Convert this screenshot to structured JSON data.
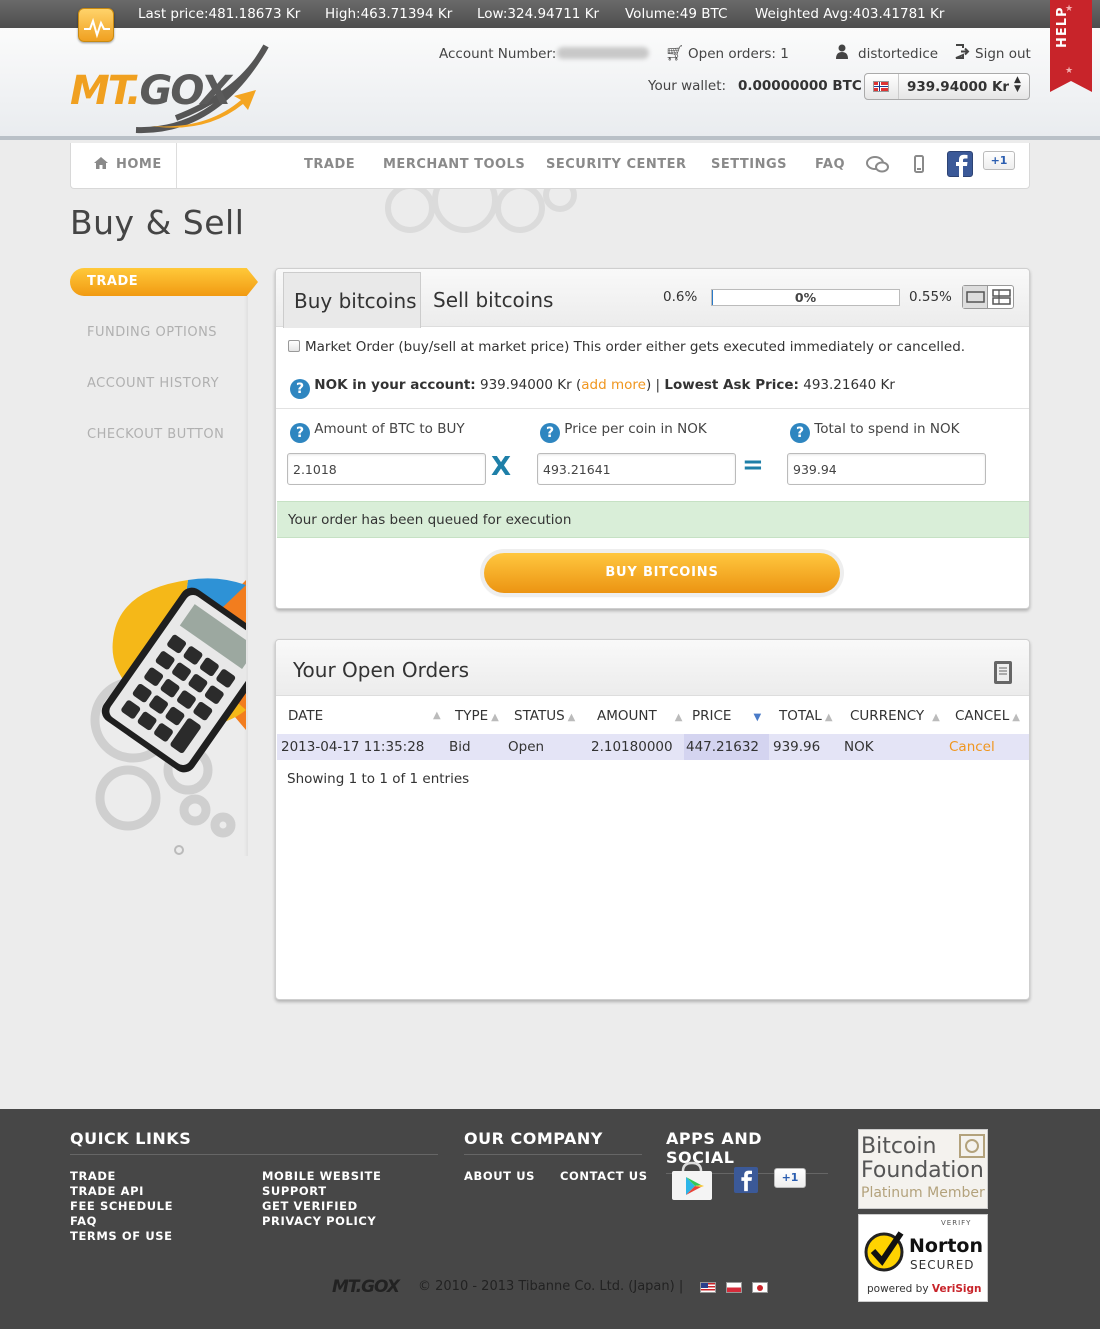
{
  "ticker": {
    "last_price": "Last price:481.18673 Kr",
    "high": "High:463.71394 Kr",
    "low": "Low:324.94711 Kr",
    "volume": "Volume:49 BTC",
    "weighted_avg": "Weighted Avg:403.41781 Kr"
  },
  "header": {
    "logo_mt": "MT.",
    "logo_gox": "GOX",
    "account_number_label": "Account Number:",
    "open_orders": "Open orders: 1",
    "username": "distortedice",
    "sign_out": "Sign out",
    "wallet_label": "Your wallet:",
    "wallet_btc": "0.00000000 BTC",
    "wallet_currency": "939.94000 Kr",
    "help": "HELP"
  },
  "nav": {
    "home": "HOME",
    "trade": "TRADE",
    "merchant_tools": "MERCHANT TOOLS",
    "security_center": "SECURITY CENTER",
    "settings": "SETTINGS",
    "faq": "FAQ",
    "plus_one": "+1"
  },
  "page": {
    "title": "Buy & Sell"
  },
  "sidebar": {
    "items": [
      {
        "label": "TRADE"
      },
      {
        "label": "FUNDING OPTIONS"
      },
      {
        "label": "ACCOUNT HISTORY"
      },
      {
        "label": "CHECKOUT BUTTON"
      }
    ]
  },
  "trade": {
    "tab_buy": "Buy bitcoins",
    "tab_sell": "Sell bitcoins",
    "fee_left": "0.6%",
    "progress_label": "0%",
    "progress_value": 0.005,
    "fee_right": "0.55%",
    "market_order_label": "Market Order (buy/sell at market price) This order either gets executed immediately or cancelled.",
    "balance_label": "NOK in your account:",
    "balance_value": "939.94000 Kr (",
    "add_more": "add more",
    "balance_close": ") |",
    "lowest_ask_label": "Lowest Ask Price:",
    "lowest_ask_value": "493.21640 Kr",
    "amount_label": "Amount of BTC to BUY",
    "price_label": "Price per coin in NOK",
    "total_label": "Total to spend in NOK",
    "amount_value": "2.1018",
    "price_value": "493.21641",
    "total_value": "939.94",
    "op_multiply": "X",
    "op_equals": "=",
    "notice": "Your order has been queued for execution",
    "buy_button": "BUY BITCOINS"
  },
  "orders": {
    "title": "Your Open Orders",
    "columns": [
      "DATE",
      "TYPE",
      "STATUS",
      "AMOUNT",
      "PRICE",
      "TOTAL",
      "CURRENCY",
      "CANCEL"
    ],
    "rows": [
      {
        "date": "2013-04-17 11:35:28",
        "type": "Bid",
        "status": "Open",
        "amount": "2.10180000",
        "price": "447.21632",
        "total": "939.96",
        "currency": "NOK",
        "cancel": "Cancel"
      }
    ],
    "showing": "Showing 1 to 1 of 1 entries"
  },
  "footer": {
    "quick_links_title": "QUICK LINKS",
    "quick_links_col1": [
      "TRADE",
      "TRADE API",
      "FEE SCHEDULE",
      "FAQ",
      "TERMS OF USE"
    ],
    "quick_links_col2": [
      "MOBILE WEBSITE",
      "SUPPORT",
      "GET VERIFIED",
      "PRIVACY POLICY"
    ],
    "company_title": "OUR COMPANY",
    "company_links": [
      "ABOUT US",
      "CONTACT US"
    ],
    "apps_title": "APPS AND SOCIAL",
    "plus_one": "+1",
    "bitcoin_foundation_1": "Bitcoin",
    "bitcoin_foundation_2": "Foundation",
    "bitcoin_foundation_3": "Platinum Member",
    "norton_verify": "VERIFY",
    "norton_name": "Norton",
    "norton_secured": "SECURED",
    "norton_powered": "powered by",
    "norton_verisign": "VeriSign",
    "logo": "MT.GOX",
    "copyright": "© 2010 - 2013 Tibanne Co. Ltd. (Japan) |"
  }
}
